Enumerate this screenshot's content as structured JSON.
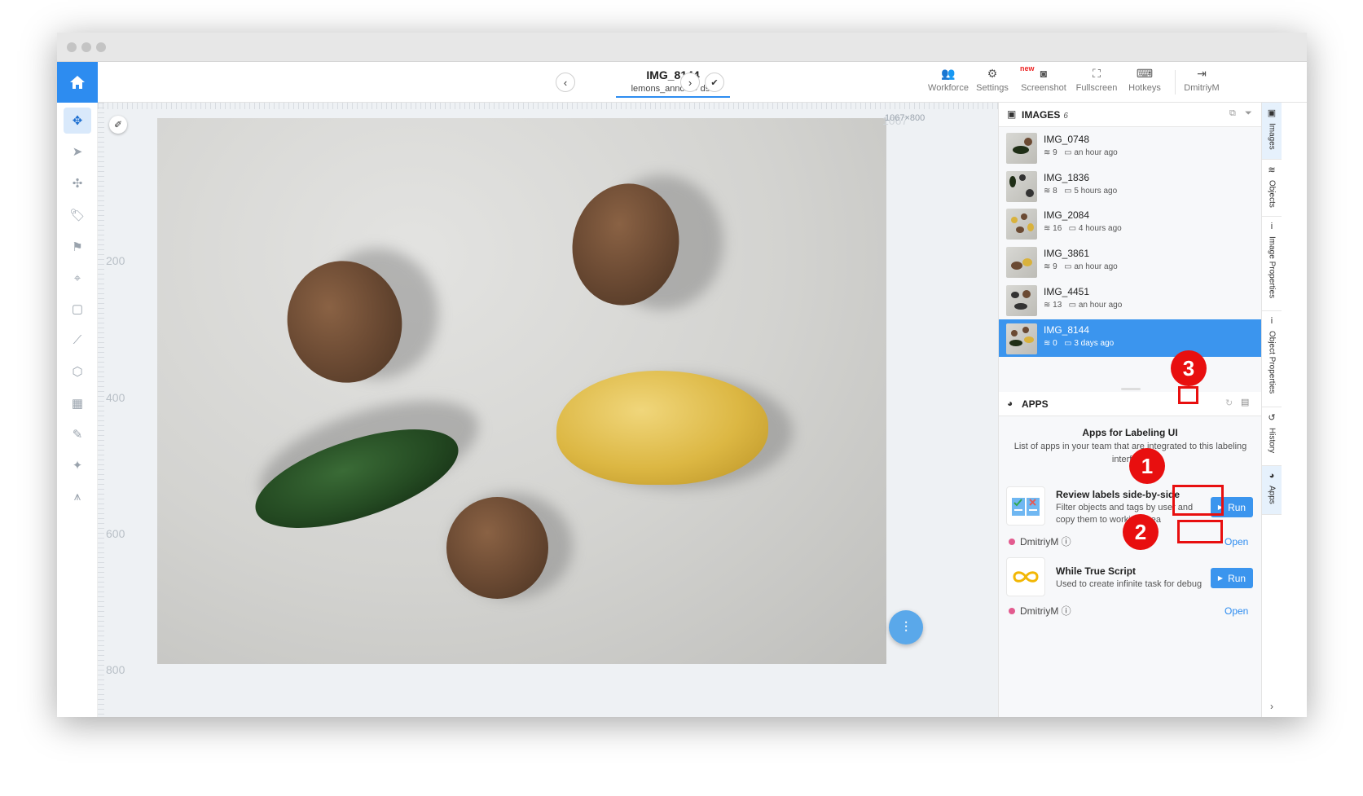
{
  "topbar": {
    "image_title": "IMG_8144",
    "breadcrumb_project": "lemons_anno...",
    "breadcrumb_sep": "›",
    "breadcrumb_dataset": "ds1",
    "new_badge": "new",
    "items": [
      {
        "label": "Workforce",
        "icon": "users-icon"
      },
      {
        "label": "Settings",
        "icon": "gear-icon"
      },
      {
        "label": "Screenshot",
        "icon": "camera-icon"
      },
      {
        "label": "Fullscreen",
        "icon": "fullscreen-icon"
      },
      {
        "label": "Hotkeys",
        "icon": "keyboard-icon"
      },
      {
        "label": "DmitriyM",
        "icon": "logout-icon"
      }
    ]
  },
  "canvas": {
    "size_label": "1067×800",
    "size_ghost": "1067",
    "ruler_labels": [
      "200",
      "400",
      "600",
      "800"
    ]
  },
  "images_panel": {
    "title": "IMAGES",
    "count": "6",
    "items": [
      {
        "name": "IMG_0748",
        "objects": "9",
        "time": "an hour ago",
        "selected": false
      },
      {
        "name": "IMG_1836",
        "objects": "8",
        "time": "5 hours ago",
        "selected": false
      },
      {
        "name": "IMG_2084",
        "objects": "16",
        "time": "4 hours ago",
        "selected": false
      },
      {
        "name": "IMG_3861",
        "objects": "9",
        "time": "an hour ago",
        "selected": false
      },
      {
        "name": "IMG_4451",
        "objects": "13",
        "time": "an hour ago",
        "selected": false
      },
      {
        "name": "IMG_8144",
        "objects": "0",
        "time": "3 days ago",
        "selected": true
      }
    ]
  },
  "apps_panel": {
    "title": "APPS",
    "heading": "Apps for Labeling UI",
    "subheading": "List of apps in your team that are integrated to this labeling interface.",
    "apps": [
      {
        "title": "Review labels side-by-side",
        "description": "Filter objects and tags by user and copy them to working area",
        "author": "DmitriyM",
        "run_label": "Run",
        "open_label": "Open"
      },
      {
        "title": "While True Script",
        "description": "Used to create infinite task for debug",
        "author": "DmitriyM",
        "run_label": "Run",
        "open_label": "Open"
      }
    ]
  },
  "side_tabs": [
    "Images",
    "Objects",
    "Image Properties",
    "Object Properties",
    "History",
    "Apps"
  ],
  "callouts": [
    "1",
    "2",
    "3"
  ],
  "colors": {
    "accent": "#2d8cf0",
    "selected_row": "#3b95ee",
    "callout_red": "#e80f0f"
  }
}
